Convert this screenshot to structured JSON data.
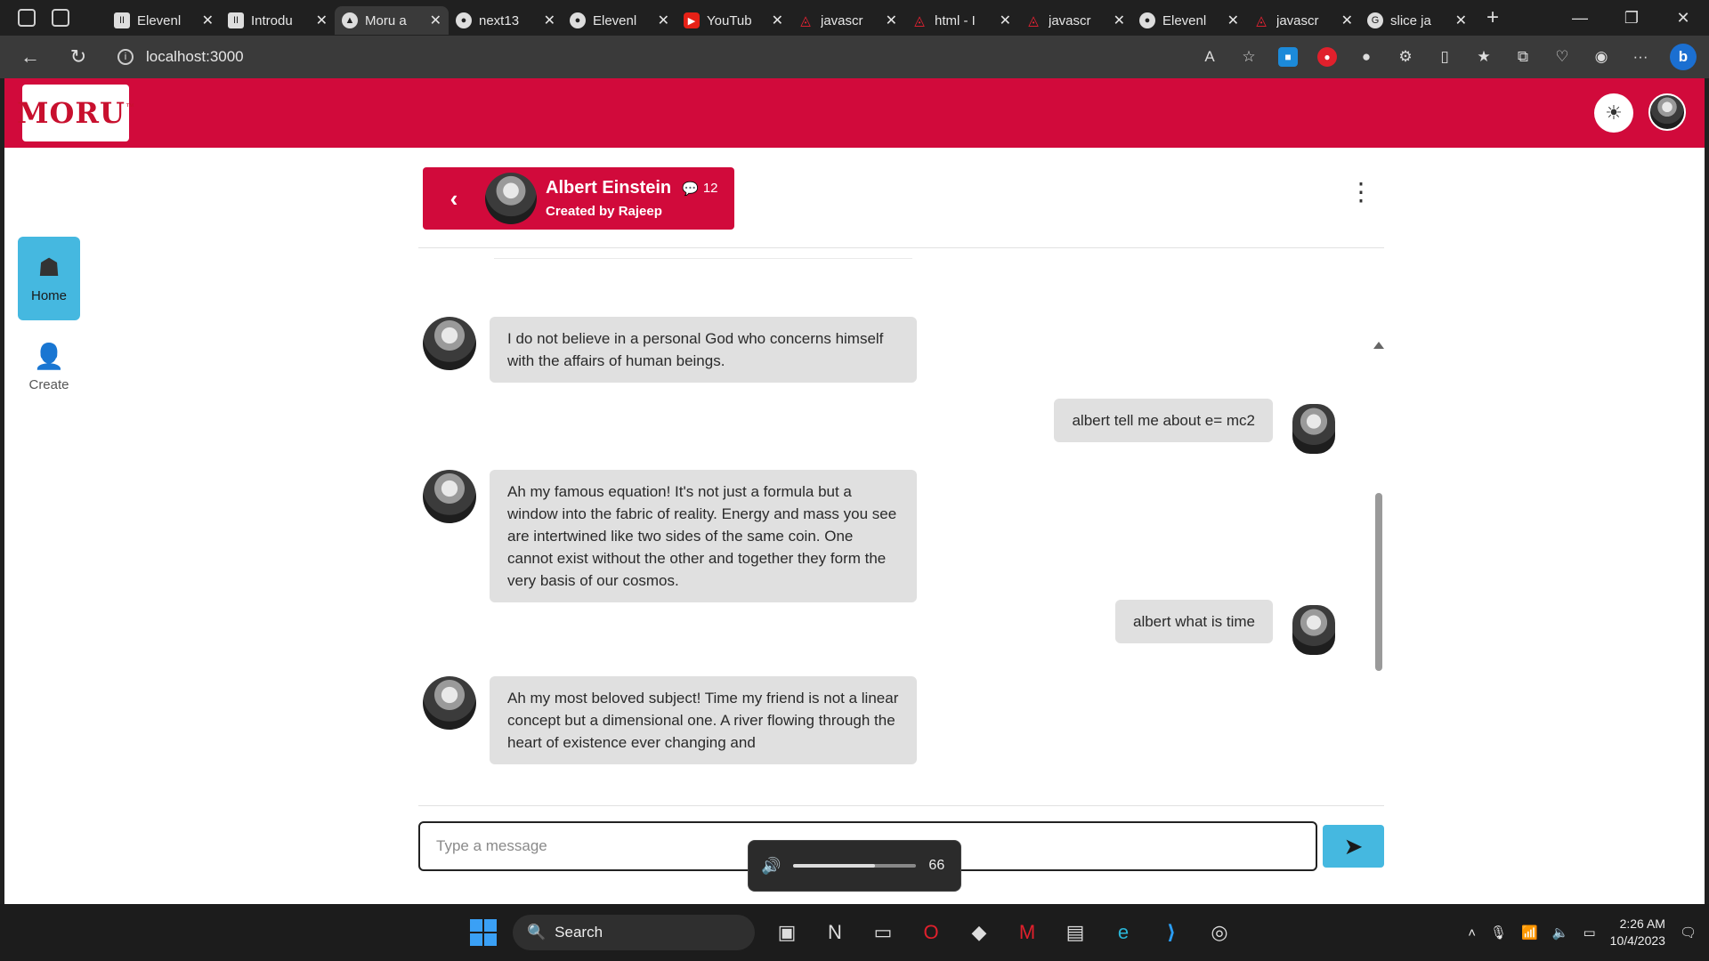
{
  "browser": {
    "tabs": [
      {
        "title": "Elevenl",
        "fav": "square"
      },
      {
        "title": "Introdu",
        "fav": "square"
      },
      {
        "title": "Moru a",
        "fav": "triangle"
      },
      {
        "title": "next13",
        "fav": "github"
      },
      {
        "title": "Elevenl",
        "fav": "github"
      },
      {
        "title": "YouTub",
        "fav": "youtube"
      },
      {
        "title": "javascr",
        "fav": "pdf"
      },
      {
        "title": "html - I",
        "fav": "pdf"
      },
      {
        "title": "javascr",
        "fav": "pdf"
      },
      {
        "title": "Elevenl",
        "fav": "github"
      },
      {
        "title": "javascr",
        "fav": "pdf"
      },
      {
        "title": "slice ja",
        "fav": "google"
      }
    ],
    "active_tab_index": 2,
    "url": "localhost:3000"
  },
  "app": {
    "logo_text": "MORU",
    "logo_tm": "™",
    "brand_color": "#d10a3b",
    "accent_color": "#45b8e0"
  },
  "sidebar": {
    "items": [
      {
        "label": "Home",
        "icon": "home-icon",
        "active": true
      },
      {
        "label": "Create",
        "icon": "add-user-icon",
        "active": false
      }
    ]
  },
  "chat": {
    "character_name": "Albert Einstein",
    "message_count": "12",
    "created_by": "Created by Rajeep",
    "messages": [
      {
        "role": "bot",
        "text": "I do not believe in a personal God who concerns himself with the affairs of human beings."
      },
      {
        "role": "user",
        "text": "albert tell me about e= mc2"
      },
      {
        "role": "bot",
        "text": "Ah my famous equation! It's not just a formula but a window into the fabric of reality. Energy and mass you see are intertwined like two sides of the same coin. One cannot exist without the other and together they form the very basis of our cosmos."
      },
      {
        "role": "user",
        "text": "albert what is time"
      },
      {
        "role": "bot",
        "text": "Ah my most beloved subject! Time my friend is not a linear concept but a dimensional one. A river flowing through the heart of existence ever changing and"
      }
    ],
    "input_placeholder": "Type a message"
  },
  "volume_overlay": {
    "value": "66",
    "level": 0.66
  },
  "taskbar": {
    "search_label": "Search",
    "time": "2:26 AM",
    "date": "10/4/2023"
  }
}
